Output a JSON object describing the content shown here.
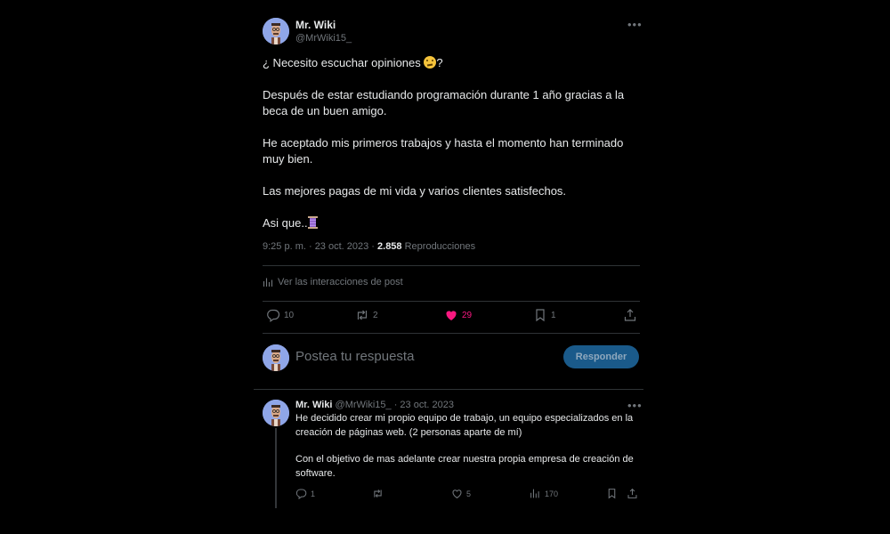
{
  "post": {
    "author_name": "Mr. Wiki",
    "author_handle": "@MrWiki15_",
    "line1": "¿ Necesito escuchar opiniones",
    "line1_end": "?",
    "para2": "Después de estar estudiando programación durante 1 año gracias a la beca de un buen amigo.",
    "para3": "He aceptado mis primeros trabajos y hasta el momento han terminado muy bien.",
    "para4": "Las mejores pagas de mi vida y varios clientes satisfechos.",
    "para5": "Asi que..",
    "time": "9:25 p. m. · 23 oct. 2023 · ",
    "views_count": "2.858",
    "views_label": "Reproducciones",
    "interactions_label": "Ver las interacciones de post",
    "replies": "10",
    "reposts": "2",
    "likes": "29",
    "bookmarks": "1",
    "like_color": "#f91880"
  },
  "reply_box": {
    "placeholder": "Postea tu respuesta",
    "button_label": "Responder"
  },
  "reply_post": {
    "author_name": "Mr. Wiki",
    "meta": "@MrWiki15_ · 23 oct. 2023",
    "para1": "He decidido crear mi propio equipo de trabajo, un equipo especializados en la creación de páginas web. (2 personas aparte de mí)",
    "para2": "Con el objetivo de mas adelante crear nuestra propia empresa de creación de software.",
    "replies": "1",
    "reposts": "",
    "likes": "5",
    "views": "170"
  },
  "icons": {
    "more": "more-dots-icon",
    "reply": "reply-icon",
    "repost": "repost-icon",
    "like": "heart-icon",
    "bookmark": "bookmark-icon",
    "share": "share-icon",
    "analytics": "analytics-icon"
  }
}
